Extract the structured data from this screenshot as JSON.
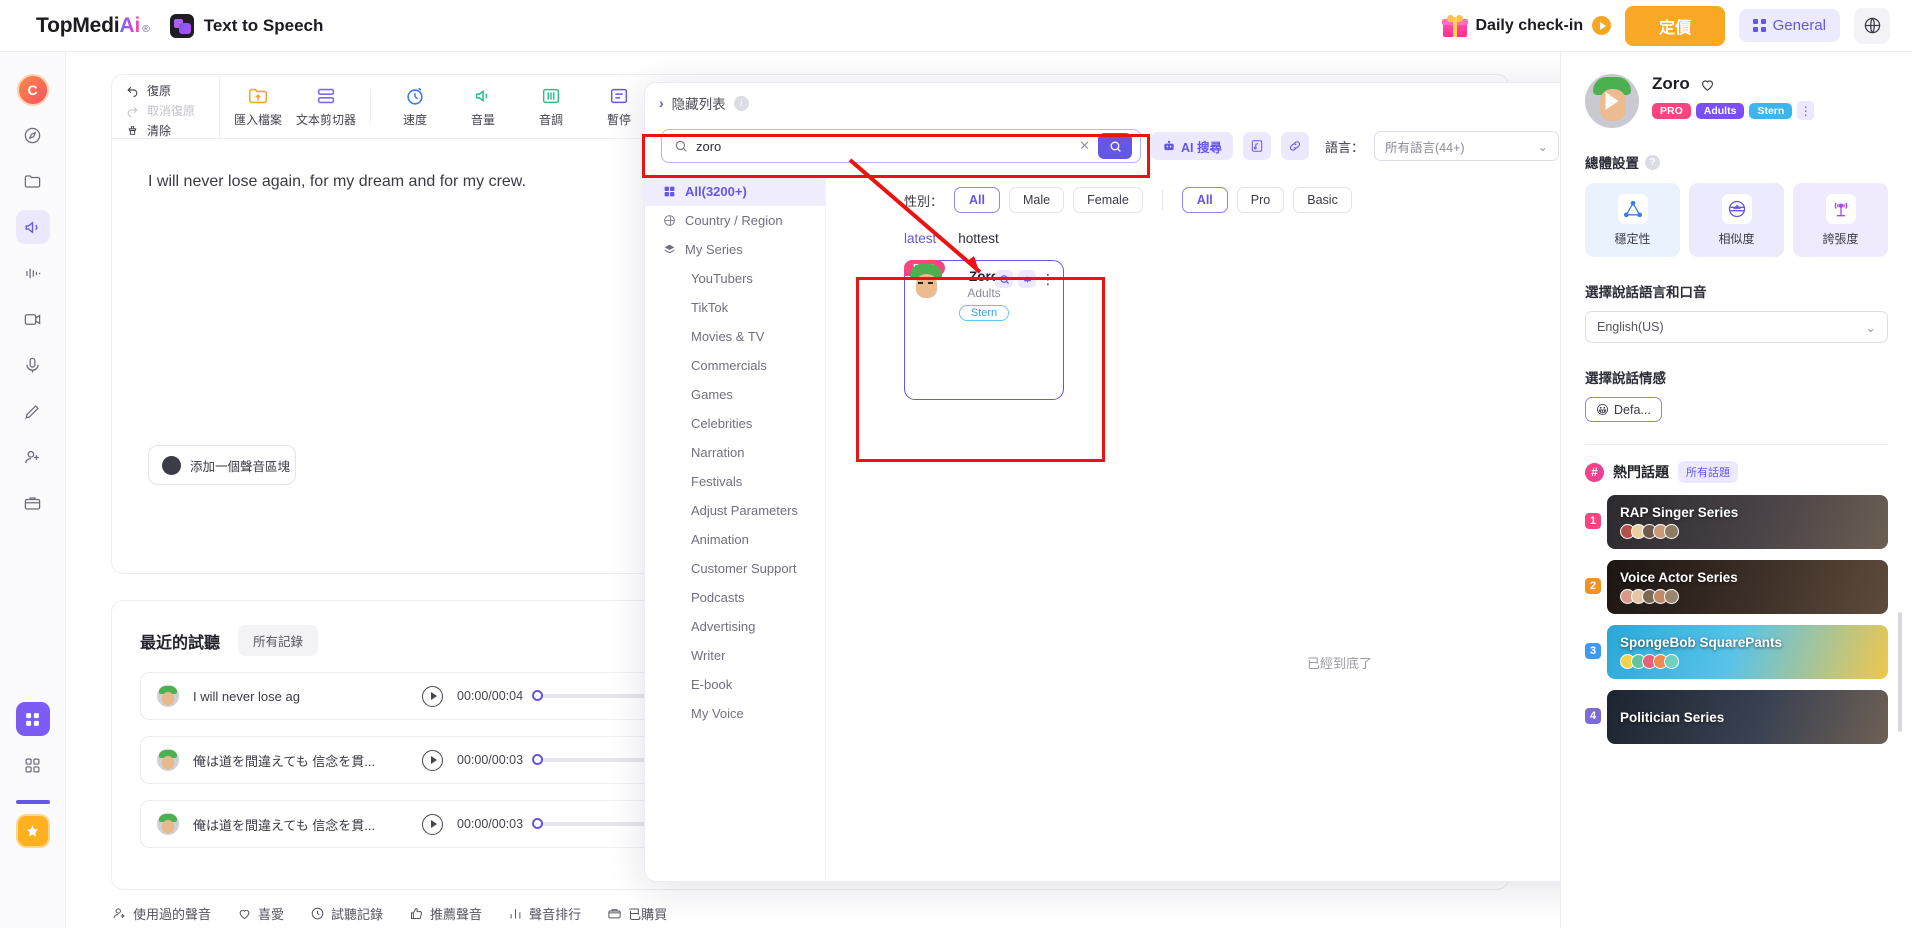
{
  "header": {
    "brand_top": "TopMedi",
    "brand_ai": "Ai",
    "brand_reg": "®",
    "app_title": "Text to Speech",
    "checkin": "Daily check-in",
    "pricing": "定價",
    "general": "General"
  },
  "rail": {
    "avatar_initial": "C"
  },
  "toolbar": {
    "undo": "復原",
    "redo": "取消復原",
    "clear": "清除",
    "items": [
      {
        "label": "匯入檔案",
        "icon": "import-folder-icon"
      },
      {
        "label": "文本剪切器",
        "icon": "text-cutter-icon"
      },
      {
        "label": "速度",
        "icon": "speed-icon"
      },
      {
        "label": "音量",
        "icon": "volume-icon"
      },
      {
        "label": "音調",
        "icon": "pitch-icon"
      },
      {
        "label": "暫停",
        "icon": "pause-icon"
      }
    ]
  },
  "editor": {
    "text": "I will never lose again, for my dream and for my crew.",
    "add_block": "添加一個聲音區塊"
  },
  "recent": {
    "title": "最近的試聽",
    "all_records": "所有記錄",
    "rows": [
      {
        "text": "I will never lose ag",
        "time": "00:00/00:04"
      },
      {
        "text": "俺は道を間違えても 信念を貫...",
        "time": "00:00/00:03"
      },
      {
        "text": "俺は道を間違えても 信念を貫...",
        "time": "00:00/00:03"
      }
    ]
  },
  "bottom_tabs": [
    {
      "label": "使用過的聲音",
      "icon": "used-voices-icon"
    },
    {
      "label": "喜愛",
      "icon": "heart-icon"
    },
    {
      "label": "試聽記錄",
      "icon": "history-clock-icon"
    },
    {
      "label": "推薦聲音",
      "icon": "thumbs-up-icon"
    },
    {
      "label": "聲音排行",
      "icon": "bar-chart-icon"
    },
    {
      "label": "已購買",
      "icon": "purchased-icon"
    }
  ],
  "modal": {
    "hide_list": "隐藏列表",
    "search_value": "zoro",
    "ai_search": "AI 搜尋",
    "language_label": "語言：",
    "language_value": "所有語言(44+)",
    "categories": [
      {
        "label": "All(3200+)",
        "icon": "grid-icon",
        "active": true,
        "indent": false
      },
      {
        "label": "Country / Region",
        "icon": "globe-icon",
        "active": false,
        "indent": false
      },
      {
        "label": "My Series",
        "icon": "layers-icon",
        "active": false,
        "indent": false
      },
      {
        "label": "YouTubers",
        "icon": "",
        "active": false,
        "indent": true
      },
      {
        "label": "TikTok",
        "icon": "",
        "active": false,
        "indent": true
      },
      {
        "label": "Movies & TV",
        "icon": "",
        "active": false,
        "indent": true
      },
      {
        "label": "Commercials",
        "icon": "",
        "active": false,
        "indent": true
      },
      {
        "label": "Games",
        "icon": "",
        "active": false,
        "indent": true
      },
      {
        "label": "Celebrities",
        "icon": "",
        "active": false,
        "indent": true
      },
      {
        "label": "Narration",
        "icon": "",
        "active": false,
        "indent": true
      },
      {
        "label": "Festivals",
        "icon": "",
        "active": false,
        "indent": true
      },
      {
        "label": "Adjust Parameters",
        "icon": "",
        "active": false,
        "indent": true
      },
      {
        "label": "Animation",
        "icon": "",
        "active": false,
        "indent": true
      },
      {
        "label": "Customer Support",
        "icon": "",
        "active": false,
        "indent": true
      },
      {
        "label": "Podcasts",
        "icon": "",
        "active": false,
        "indent": true
      },
      {
        "label": "Advertising",
        "icon": "",
        "active": false,
        "indent": true
      },
      {
        "label": "Writer",
        "icon": "",
        "active": false,
        "indent": true
      },
      {
        "label": "E-book",
        "icon": "",
        "active": false,
        "indent": true
      },
      {
        "label": "My Voice",
        "icon": "",
        "active": false,
        "indent": true
      }
    ],
    "gender_label": "性別：",
    "gender_options": [
      "All",
      "Male",
      "Female"
    ],
    "gender_selected": "All",
    "tier_options": [
      "All",
      "Pro",
      "Basic"
    ],
    "tier_selected": "All",
    "sort": {
      "latest": "latest",
      "hottest": "hottest"
    },
    "card": {
      "pro": "PRO",
      "name": "Zoro",
      "age": "Adults",
      "style": "Stern"
    },
    "end_note": "已經到底了"
  },
  "right_panel": {
    "name": "Zoro",
    "tags": [
      "PRO",
      "Adults",
      "Stern"
    ],
    "overall_settings": "總體設置",
    "tiles": [
      {
        "label": "穩定性",
        "icon": "stability-triangle-icon"
      },
      {
        "label": "相似度",
        "icon": "similarity-icon"
      },
      {
        "label": "誇張度",
        "icon": "exaggeration-antenna-icon"
      }
    ],
    "lang_section": "選擇說話語言和口音",
    "lang_value": "English(US)",
    "emotion_section": "選擇說話情感",
    "emotion_value": "Defa...",
    "hot_title": "熱門話題",
    "hot_all": "所有話題",
    "hot_items": [
      {
        "rank": "1",
        "name": "RAP Singer Series"
      },
      {
        "rank": "2",
        "name": "Voice Actor Series"
      },
      {
        "rank": "3",
        "name": "SpongeBob SquarePants"
      },
      {
        "rank": "4",
        "name": "Politician Series"
      }
    ]
  },
  "colors": {
    "accent": "#6457e8",
    "pricing": "#f9a825",
    "pro_badge": "#f8447f",
    "annotation": "#ee1111"
  }
}
